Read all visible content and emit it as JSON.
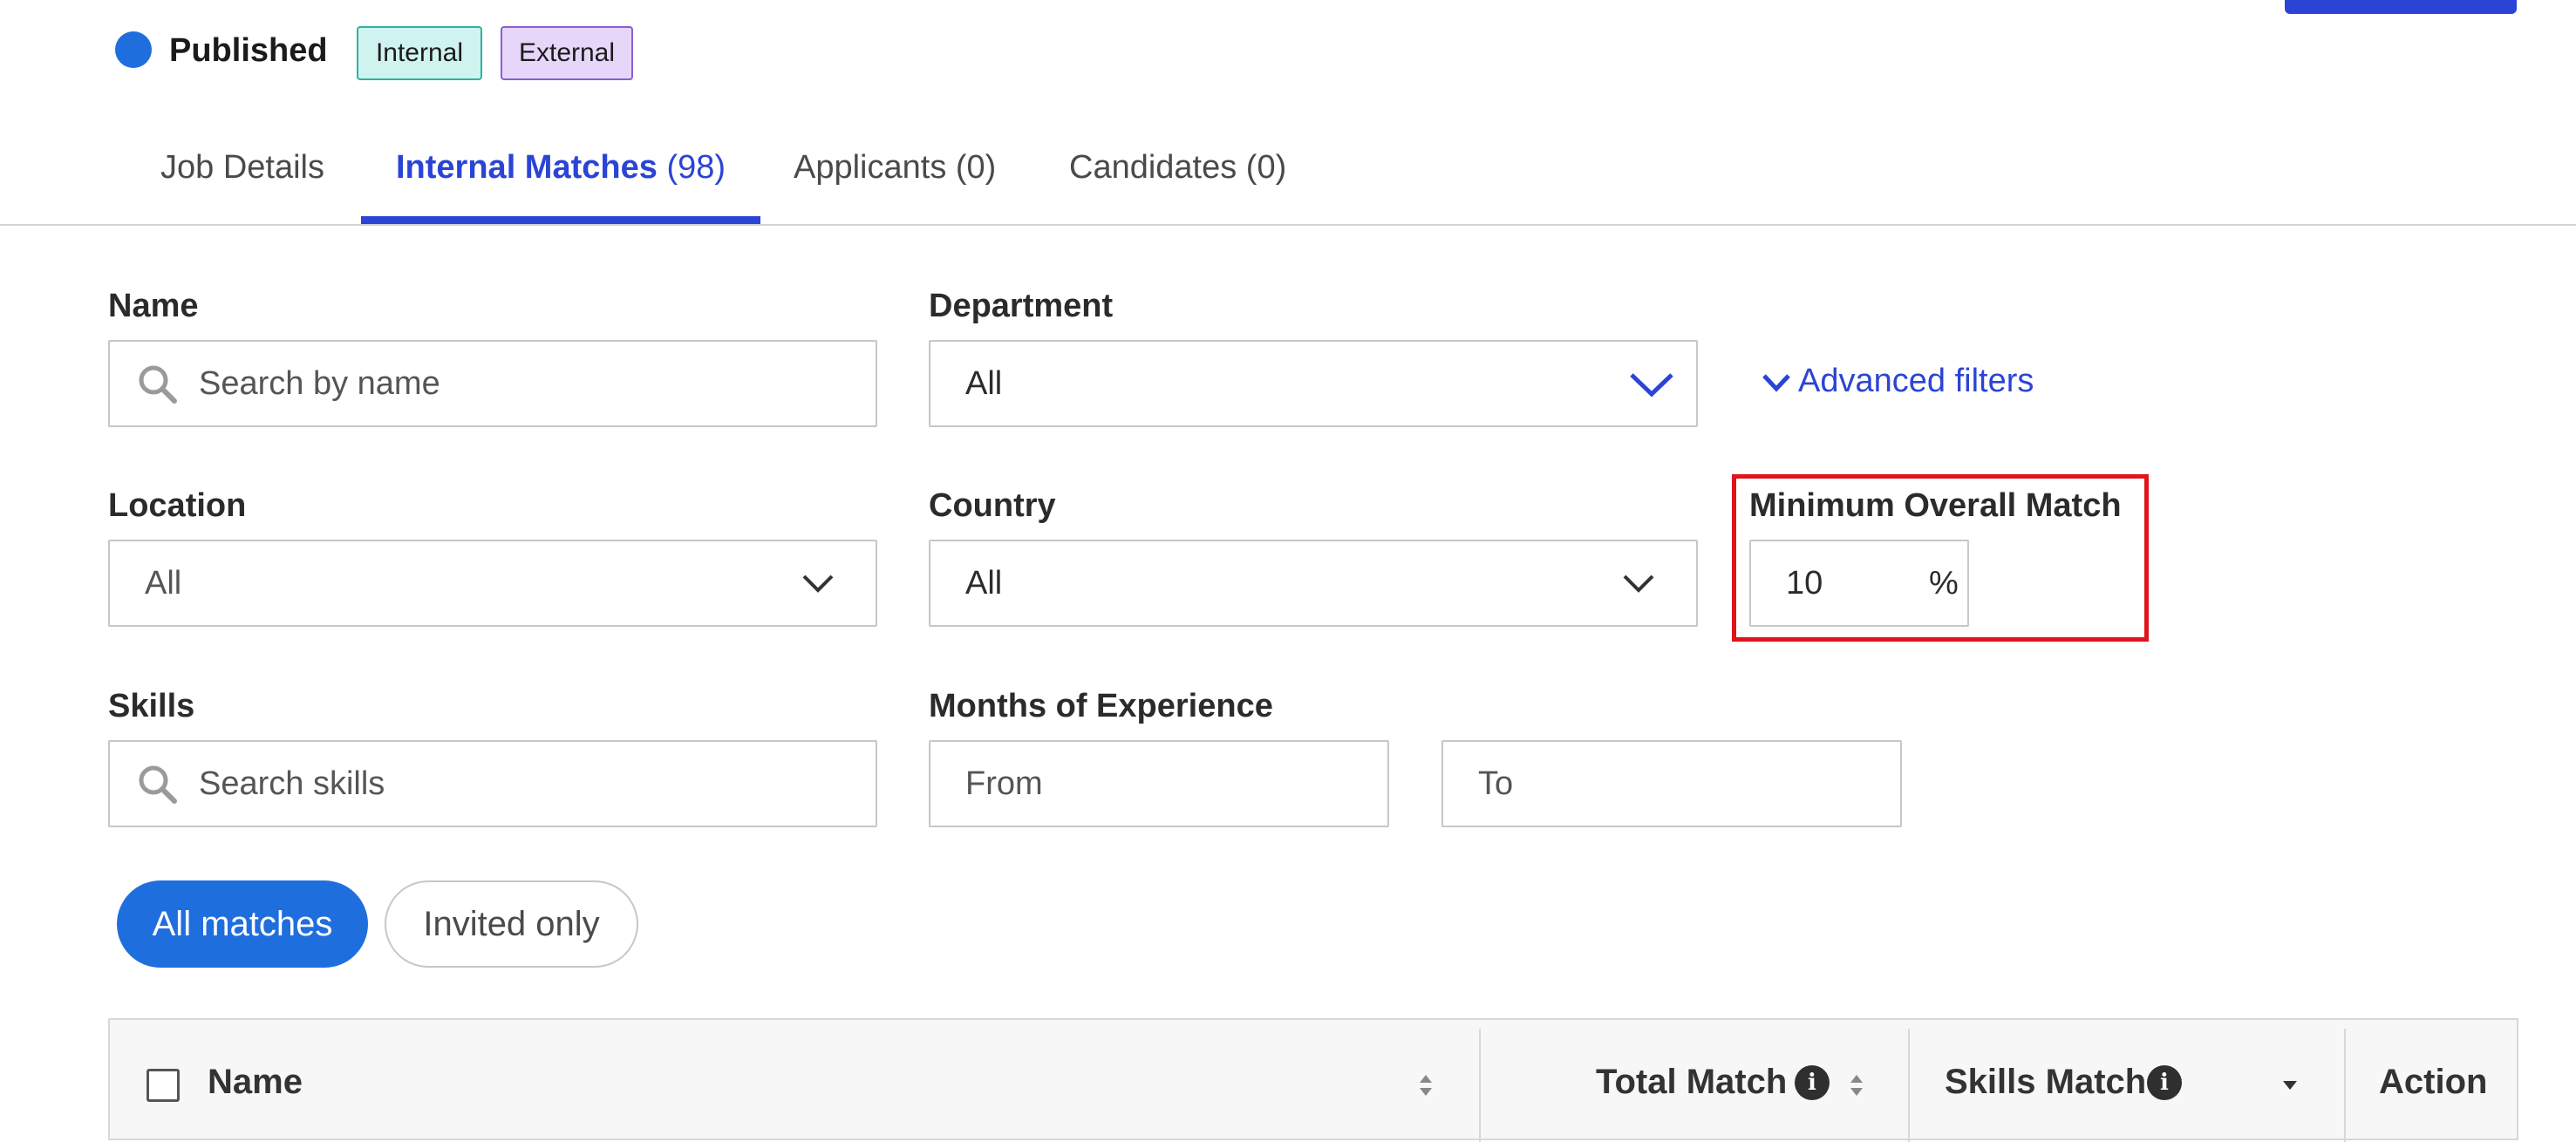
{
  "status": {
    "label": "Published",
    "badges": {
      "internal": "Internal",
      "external": "External"
    }
  },
  "tabs": [
    {
      "label": "Job Details"
    },
    {
      "label": "Internal Matches",
      "count": "(98)",
      "active": true
    },
    {
      "label": "Applicants (0)"
    },
    {
      "label": "Candidates (0)"
    }
  ],
  "filters": {
    "name": {
      "label": "Name",
      "placeholder": "Search by name"
    },
    "department": {
      "label": "Department",
      "value": "All"
    },
    "advanced_filters": "Advanced filters",
    "location": {
      "label": "Location",
      "value": "All"
    },
    "country": {
      "label": "Country",
      "value": "All"
    },
    "min_match": {
      "label": "Minimum Overall Match",
      "value": "10",
      "unit": "%"
    },
    "skills": {
      "label": "Skills",
      "placeholder": "Search skills"
    },
    "experience": {
      "label": "Months of Experience",
      "from_placeholder": "From",
      "to_placeholder": "To"
    }
  },
  "toggle": {
    "all": "All matches",
    "invited": "Invited only"
  },
  "table": {
    "columns": {
      "name": "Name",
      "total_match": "Total Match",
      "skills_match": "Skills Match",
      "action": "Action"
    }
  },
  "icons": {
    "search": "search-icon",
    "chevron": "chevron-down-icon",
    "info": "info-icon",
    "sort": "sort-icon"
  },
  "colors": {
    "accent": "#2b44d6",
    "status_dot": "#1f6ede",
    "highlight": "#e0141c",
    "badge_internal": "#cff3ee",
    "badge_external": "#e6d6fa"
  }
}
